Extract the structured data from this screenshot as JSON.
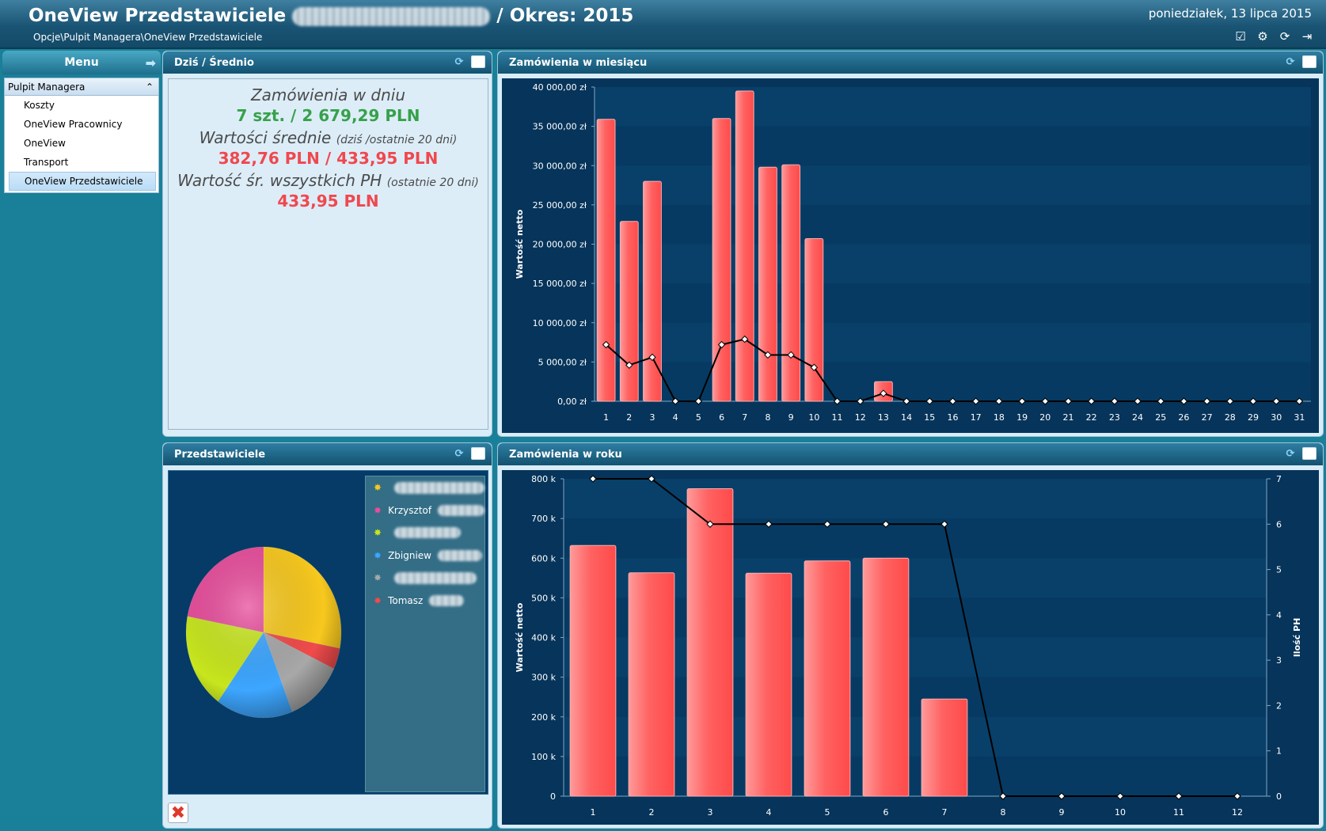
{
  "header": {
    "title": "OneView Przedstawiciele",
    "period": "/ Okres: 2015",
    "breadcrumb": "Opcje\\Pulpit Managera\\OneView Przedstawiciele",
    "date": "poniedziałek, 13 lipca 2015"
  },
  "icons": [
    "checklist-icon",
    "settings-icon",
    "refresh-icon",
    "exit-icon"
  ],
  "sidebar": {
    "title": "Menu",
    "group": "Pulpit Managera",
    "items": [
      {
        "label": "Koszty"
      },
      {
        "label": "OneView Pracownicy"
      },
      {
        "label": "OneView"
      },
      {
        "label": "Transport"
      },
      {
        "label": "OneView Przedstawiciele",
        "selected": true
      }
    ]
  },
  "today": {
    "title": "Dziś / Średnio",
    "l1": "Zamówienia w dniu",
    "l2": "7 szt. / 2 679,29 PLN",
    "l3": "Wartości średnie",
    "l3s": "(dziś /ostatnie 20 dni)",
    "l4": "382,76 PLN / 433,95 PLN",
    "l5": "Wartość śr. wszystkich PH",
    "l5s": "(ostatnie 20 dni)",
    "l6": "433,95 PLN"
  },
  "monthly": {
    "title": "Zamówienia w miesiącu"
  },
  "reps": {
    "title": "Przedstawiciele",
    "legend": [
      {
        "name": "",
        "color": "#f7c81e"
      },
      {
        "name": "Krzysztof",
        "color": "#e84d9c"
      },
      {
        "name": "",
        "color": "#c8e61e"
      },
      {
        "name": "Zbigniew",
        "color": "#3da6ff"
      },
      {
        "name": "",
        "color": "#a8a8a8"
      },
      {
        "name": "Tomasz",
        "color": "#f04b4b"
      }
    ]
  },
  "yearly": {
    "title": "Zamówienia w roku"
  },
  "chart_data": [
    {
      "type": "bar",
      "title": "Zamówienia w miesiącu",
      "ylabel": "Wartość netto",
      "ylim": [
        0,
        40000
      ],
      "yticks": [
        "0,00 zł",
        "5 000,00 zł",
        "10 000,00 zł",
        "15 000,00 zł",
        "20 000,00 zł",
        "25 000,00 zł",
        "30 000,00 zł",
        "35 000,00 zł",
        "40 000,00 zł"
      ],
      "categories": [
        1,
        2,
        3,
        4,
        5,
        6,
        7,
        8,
        9,
        10,
        11,
        12,
        13,
        14,
        15,
        16,
        17,
        18,
        19,
        20,
        21,
        22,
        23,
        24,
        25,
        26,
        27,
        28,
        29,
        30,
        31
      ],
      "values": [
        35900,
        22900,
        28000,
        0,
        0,
        36000,
        39500,
        29800,
        30100,
        20700,
        0,
        0,
        2500,
        0,
        0,
        0,
        0,
        0,
        0,
        0,
        0,
        0,
        0,
        0,
        0,
        0,
        0,
        0,
        0,
        0,
        0
      ],
      "line_values": [
        7200,
        4600,
        5600,
        0,
        0,
        7200,
        7900,
        5900,
        5900,
        4300,
        0,
        0,
        1000,
        0,
        0,
        0,
        0,
        0,
        0,
        0,
        0,
        0,
        0,
        0,
        0,
        0,
        0,
        0,
        0,
        0,
        0
      ]
    },
    {
      "type": "pie",
      "title": "Przedstawiciele",
      "values": [
        28,
        4,
        12,
        16,
        18,
        22
      ],
      "colors": [
        "#f7c81e",
        "#f04b4b",
        "#a8a8a8",
        "#3da6ff",
        "#c8e61e",
        "#e84d9c"
      ]
    },
    {
      "type": "bar",
      "title": "Zamówienia w roku",
      "ylabel": "Wartość netto",
      "y2label": "Ilość PH",
      "ylim": [
        0,
        800
      ],
      "y2lim": [
        0,
        7
      ],
      "yticks": [
        "0",
        "100 k",
        "200 k",
        "300 k",
        "400 k",
        "500 k",
        "600 k",
        "700 k",
        "800 k"
      ],
      "categories": [
        1,
        2,
        3,
        4,
        5,
        6,
        7,
        8,
        9,
        10,
        11,
        12
      ],
      "values": [
        632,
        563,
        775,
        562,
        593,
        600,
        245,
        0,
        0,
        0,
        0,
        0
      ],
      "line_values": [
        7,
        7,
        6,
        6,
        6,
        6,
        6,
        0,
        0,
        0,
        0,
        0
      ]
    }
  ]
}
